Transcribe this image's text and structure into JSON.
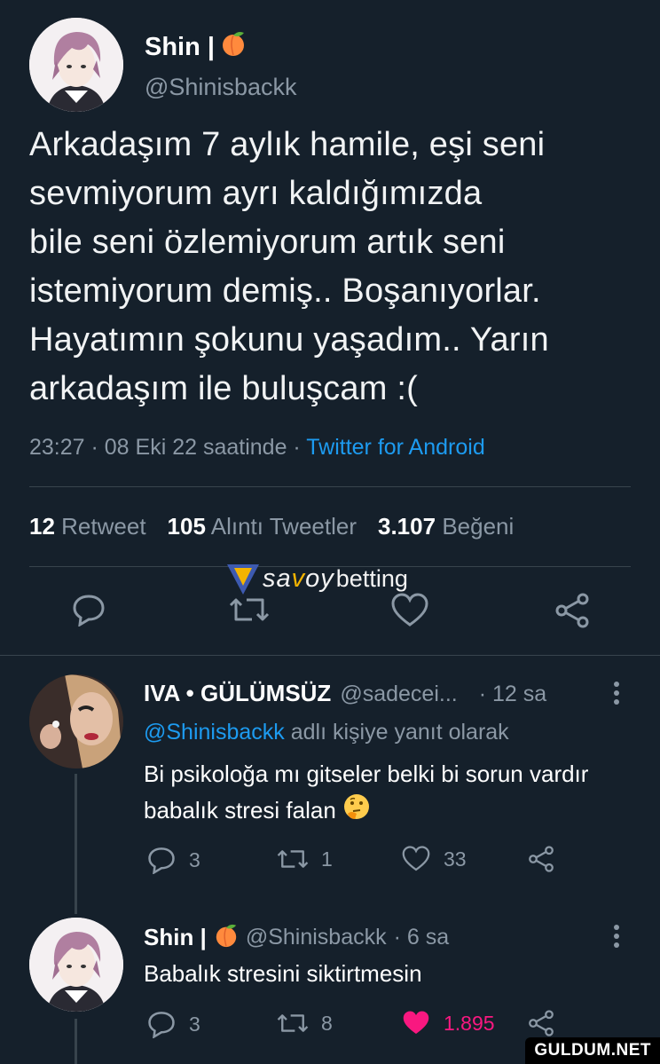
{
  "main_tweet": {
    "author_name": "Shin |",
    "author_emoji": "peach-icon",
    "handle": "@Shinisbackk",
    "text": "Arkadaşım 7 aylık hamile, eşi seni\nsevmiyorum ayrı kaldığımızda\nbile seni özlemiyorum artık seni\nistemiyorum demiş.. Boşanıyorlar.\nHayatımın şokunu yaşadım.. Yarın\narkadaşım ile buluşcam :(",
    "timestamp": "23:27 · 08 Eki 22 saatinde ·",
    "source": "Twitter for Android",
    "stats": {
      "retweets_count": "12",
      "retweets_label": "Retweet",
      "quotes_count": "105",
      "quotes_label": "Alıntı Tweetler",
      "likes_count": "3.107",
      "likes_label": "Beğeni"
    },
    "actions": [
      "reply-icon",
      "retweet-icon",
      "like-icon",
      "share-icon"
    ]
  },
  "overlay_logo": {
    "brand_part1_a": "sa",
    "brand_part1_o": "v",
    "brand_part1_b": "oy",
    "brand_part2": "betting"
  },
  "replies": [
    {
      "author_name": "IVA • GÜLÜMSÜZ",
      "handle": "@sadecei...",
      "time": "· 12 sa",
      "reply_to_mention": "@Shinisbackk",
      "reply_to_suffix": "adlı kişiye yanıt olarak",
      "text": "Bi psikoloğa mı gitseler belki bi sorun vardır babalık stresi falan",
      "emoji": "thinking-face-icon",
      "reply_count": "3",
      "retweet_count": "1",
      "like_count": "33"
    },
    {
      "author_name": "Shin |",
      "author_emoji": "peach-icon",
      "handle": "@Shinisbackk",
      "time": "· 6 sa",
      "text": "Babalık stresini siktirtmesin",
      "reply_count": "3",
      "retweet_count": "8",
      "like_count": "1.895",
      "liked": true
    }
  ],
  "watermark": "GULDUM.NET"
}
